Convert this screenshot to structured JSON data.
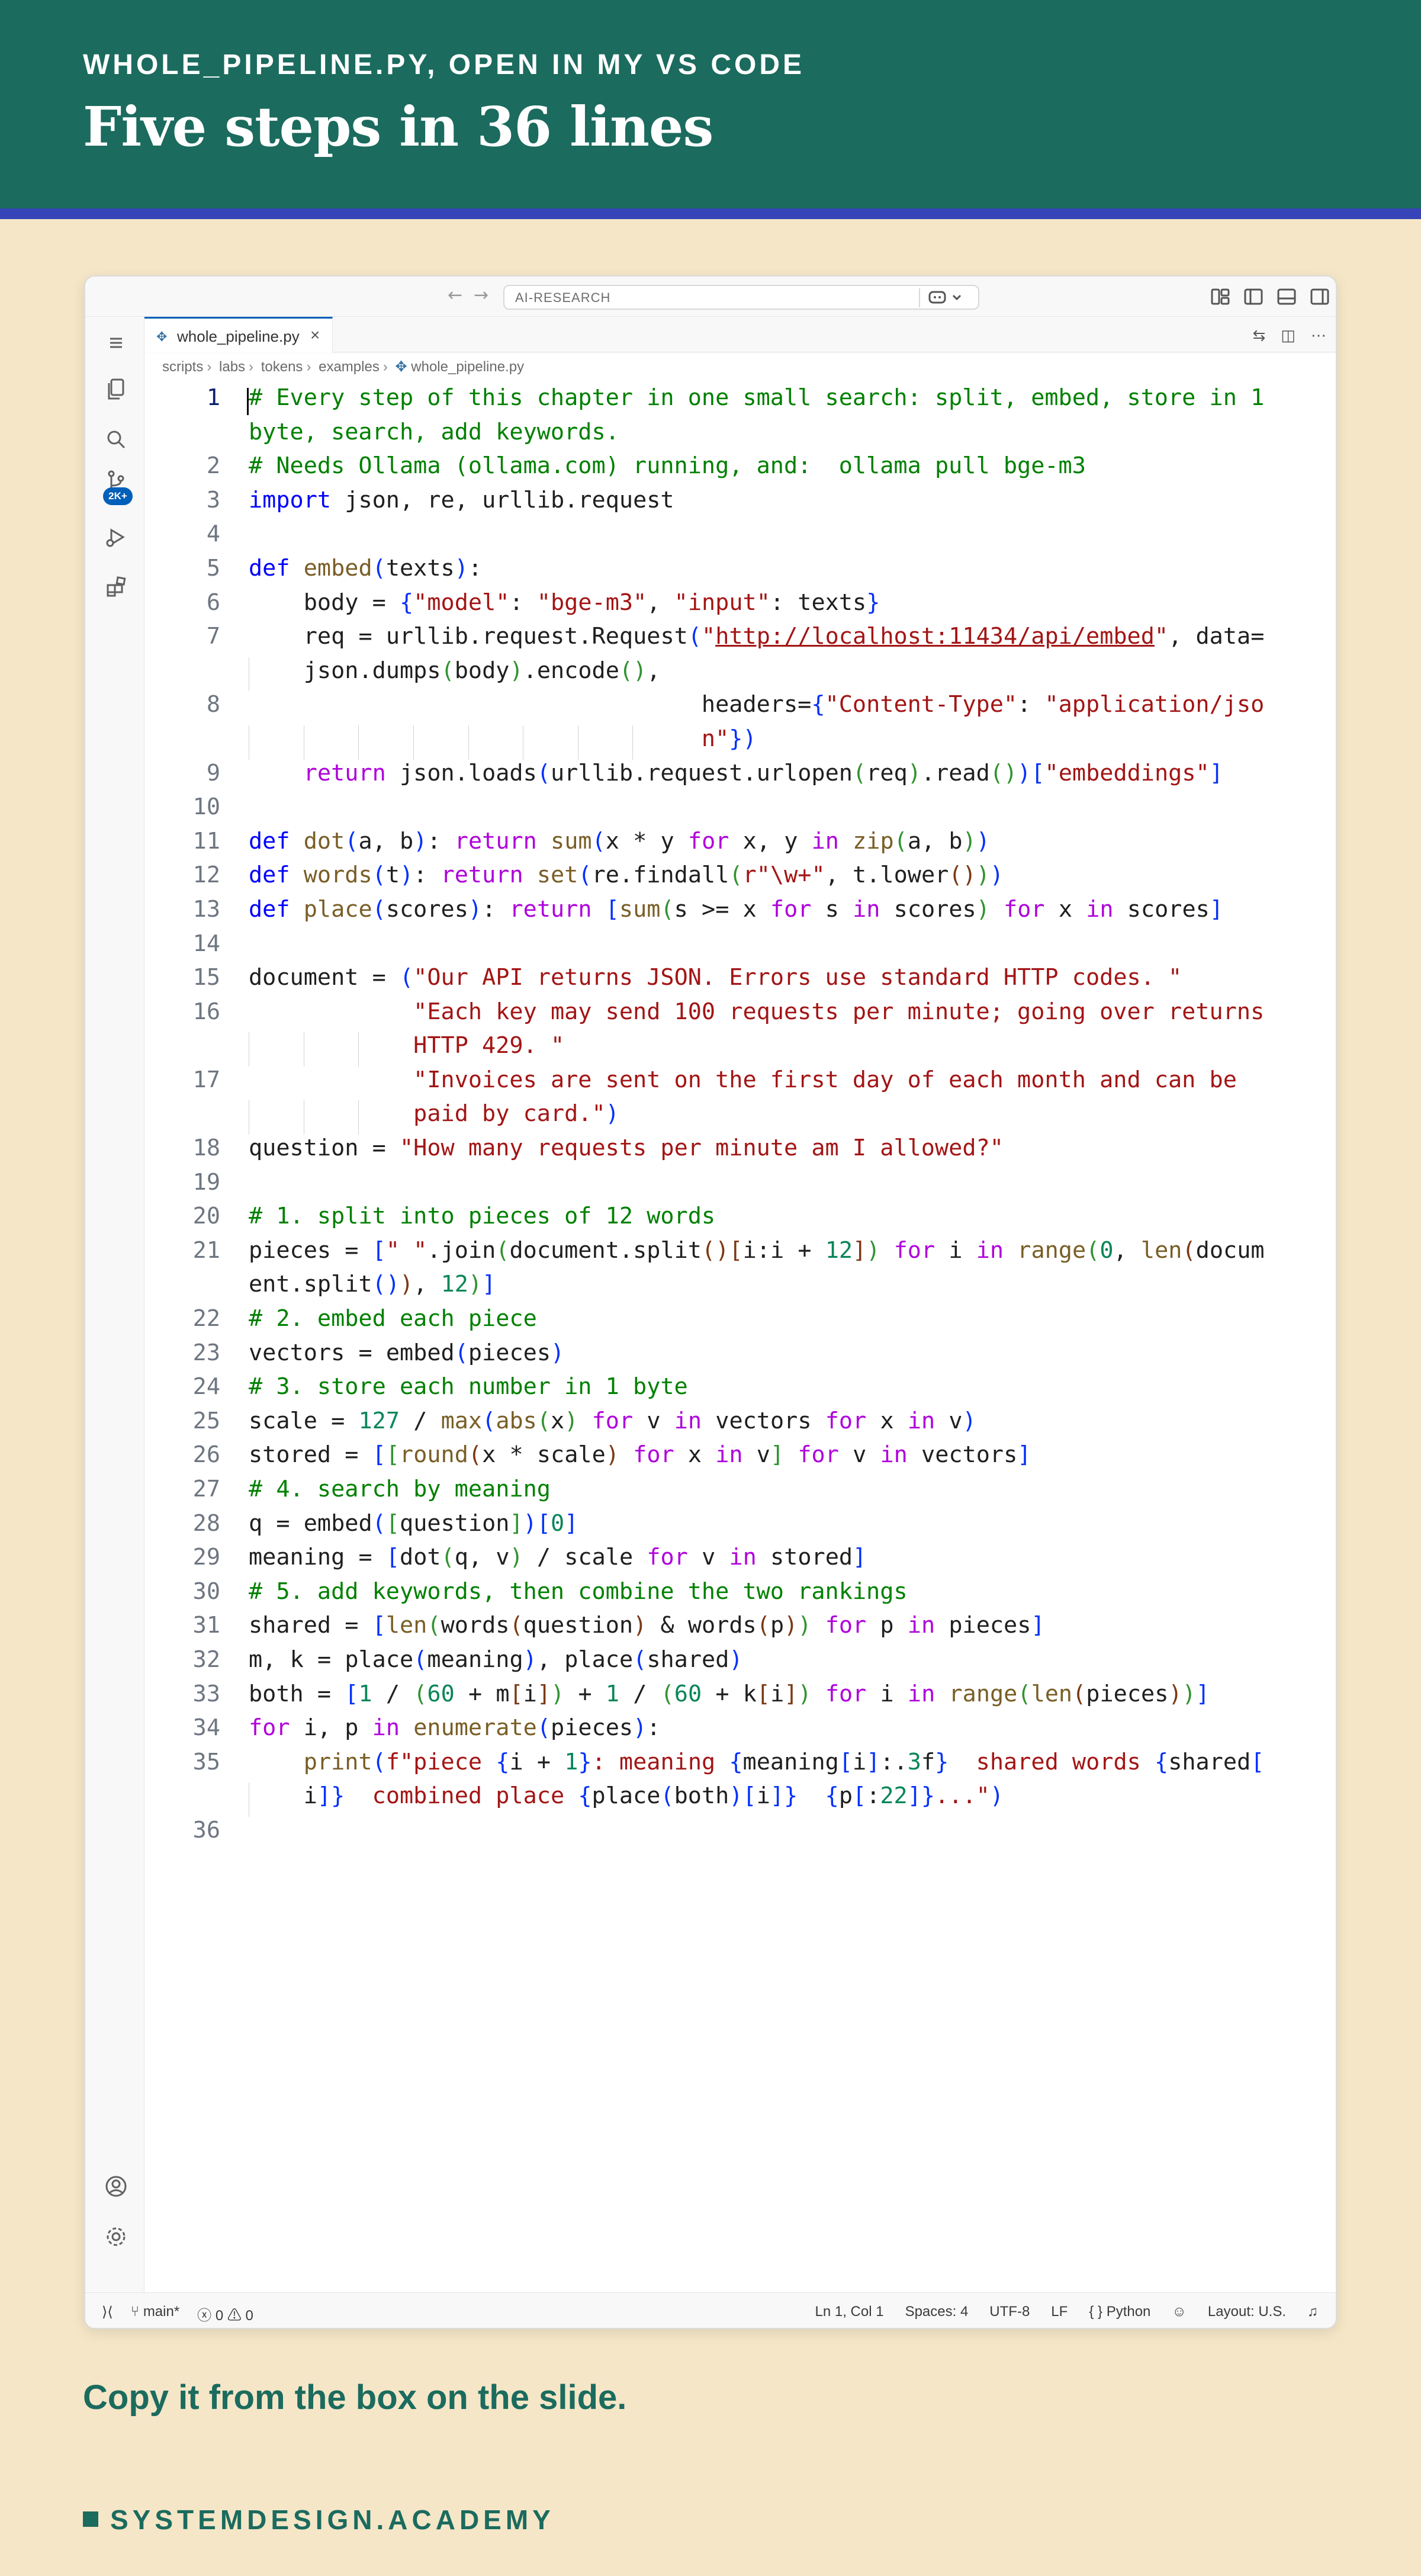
{
  "slide": {
    "kicker": "WHOLE_PIPELINE.PY, OPEN IN MY VS CODE",
    "title": "Five steps in 36 lines",
    "footer": "Copy it from the box on the slide.",
    "brand": "SYSTEMDESIGN.ACADEMY",
    "colors": {
      "banner": "#1b6b5e",
      "stripe": "#3644b8",
      "background": "#f5e6c7"
    }
  },
  "window": {
    "search_text": "AI-RESEARCH",
    "tab_label": "whole_pipeline.py",
    "breadcrumb": [
      "scripts",
      "labs",
      "tokens",
      "examples",
      "whole_pipeline.py"
    ],
    "scm_badge": "2K+",
    "status": {
      "branch": "main*",
      "errors": "0",
      "warnings": "0",
      "position": "Ln 1, Col 1",
      "spaces": "Spaces: 4",
      "encoding": "UTF-8",
      "eol": "LF",
      "language": "Python",
      "layout": "Layout: U.S."
    }
  },
  "code_lines": [
    "# Every step of this chapter in one small search: split, embed, store in 1 byte, search, add keywords.",
    "# Needs Ollama (ollama.com) running, and:  ollama pull bge-m3",
    "import json, re, urllib.request",
    "",
    "def embed(texts):",
    "    body = {\"model\": \"bge-m3\", \"input\": texts}",
    "    req = urllib.request.Request(\"http://localhost:11434/api/embed\", data=json.dumps(body).encode(),",
    "                                 headers={\"Content-Type\": \"application/json\"})",
    "    return json.loads(urllib.request.urlopen(req).read())[\"embeddings\"]",
    "",
    "def dot(a, b): return sum(x * y for x, y in zip(a, b))",
    "def words(t): return set(re.findall(r\"\\w+\", t.lower()))",
    "def place(scores): return [sum(s >= x for s in scores) for x in scores]",
    "",
    "document = (\"Our API returns JSON. Errors use standard HTTP codes. \"",
    "            \"Each key may send 100 requests per minute; going over returns HTTP 429. \"",
    "            \"Invoices are sent on the first day of each month and can be paid by card.\")",
    "question = \"How many requests per minute am I allowed?\"",
    "",
    "# 1. split into pieces of 12 words",
    "pieces = [\" \".join(document.split()[i:i + 12]) for i in range(0, len(document.split()), 12)]",
    "# 2. embed each piece",
    "vectors = embed(pieces)",
    "# 3. store each number in 1 byte",
    "scale = 127 / max(abs(x) for v in vectors for x in v)",
    "stored = [[round(x * scale) for x in v] for v in vectors]",
    "# 4. search by meaning",
    "q = embed([question])[0]",
    "meaning = [dot(q, v) / scale for v in stored]",
    "# 5. add keywords, then combine the two rankings",
    "shared = [len(words(question) & words(p)) for p in pieces]",
    "m, k = place(meaning), place(shared)",
    "both = [1 / (60 + m[i]) + 1 / (60 + k[i]) for i in range(len(pieces))]",
    "for i, p in enumerate(pieces):",
    "    print(f\"piece {i + 1}: meaning {meaning[i]:.3f}  shared words {shared[i]}  combined place {place(both)[i]}  {p[:22]}...\")",
    ""
  ]
}
